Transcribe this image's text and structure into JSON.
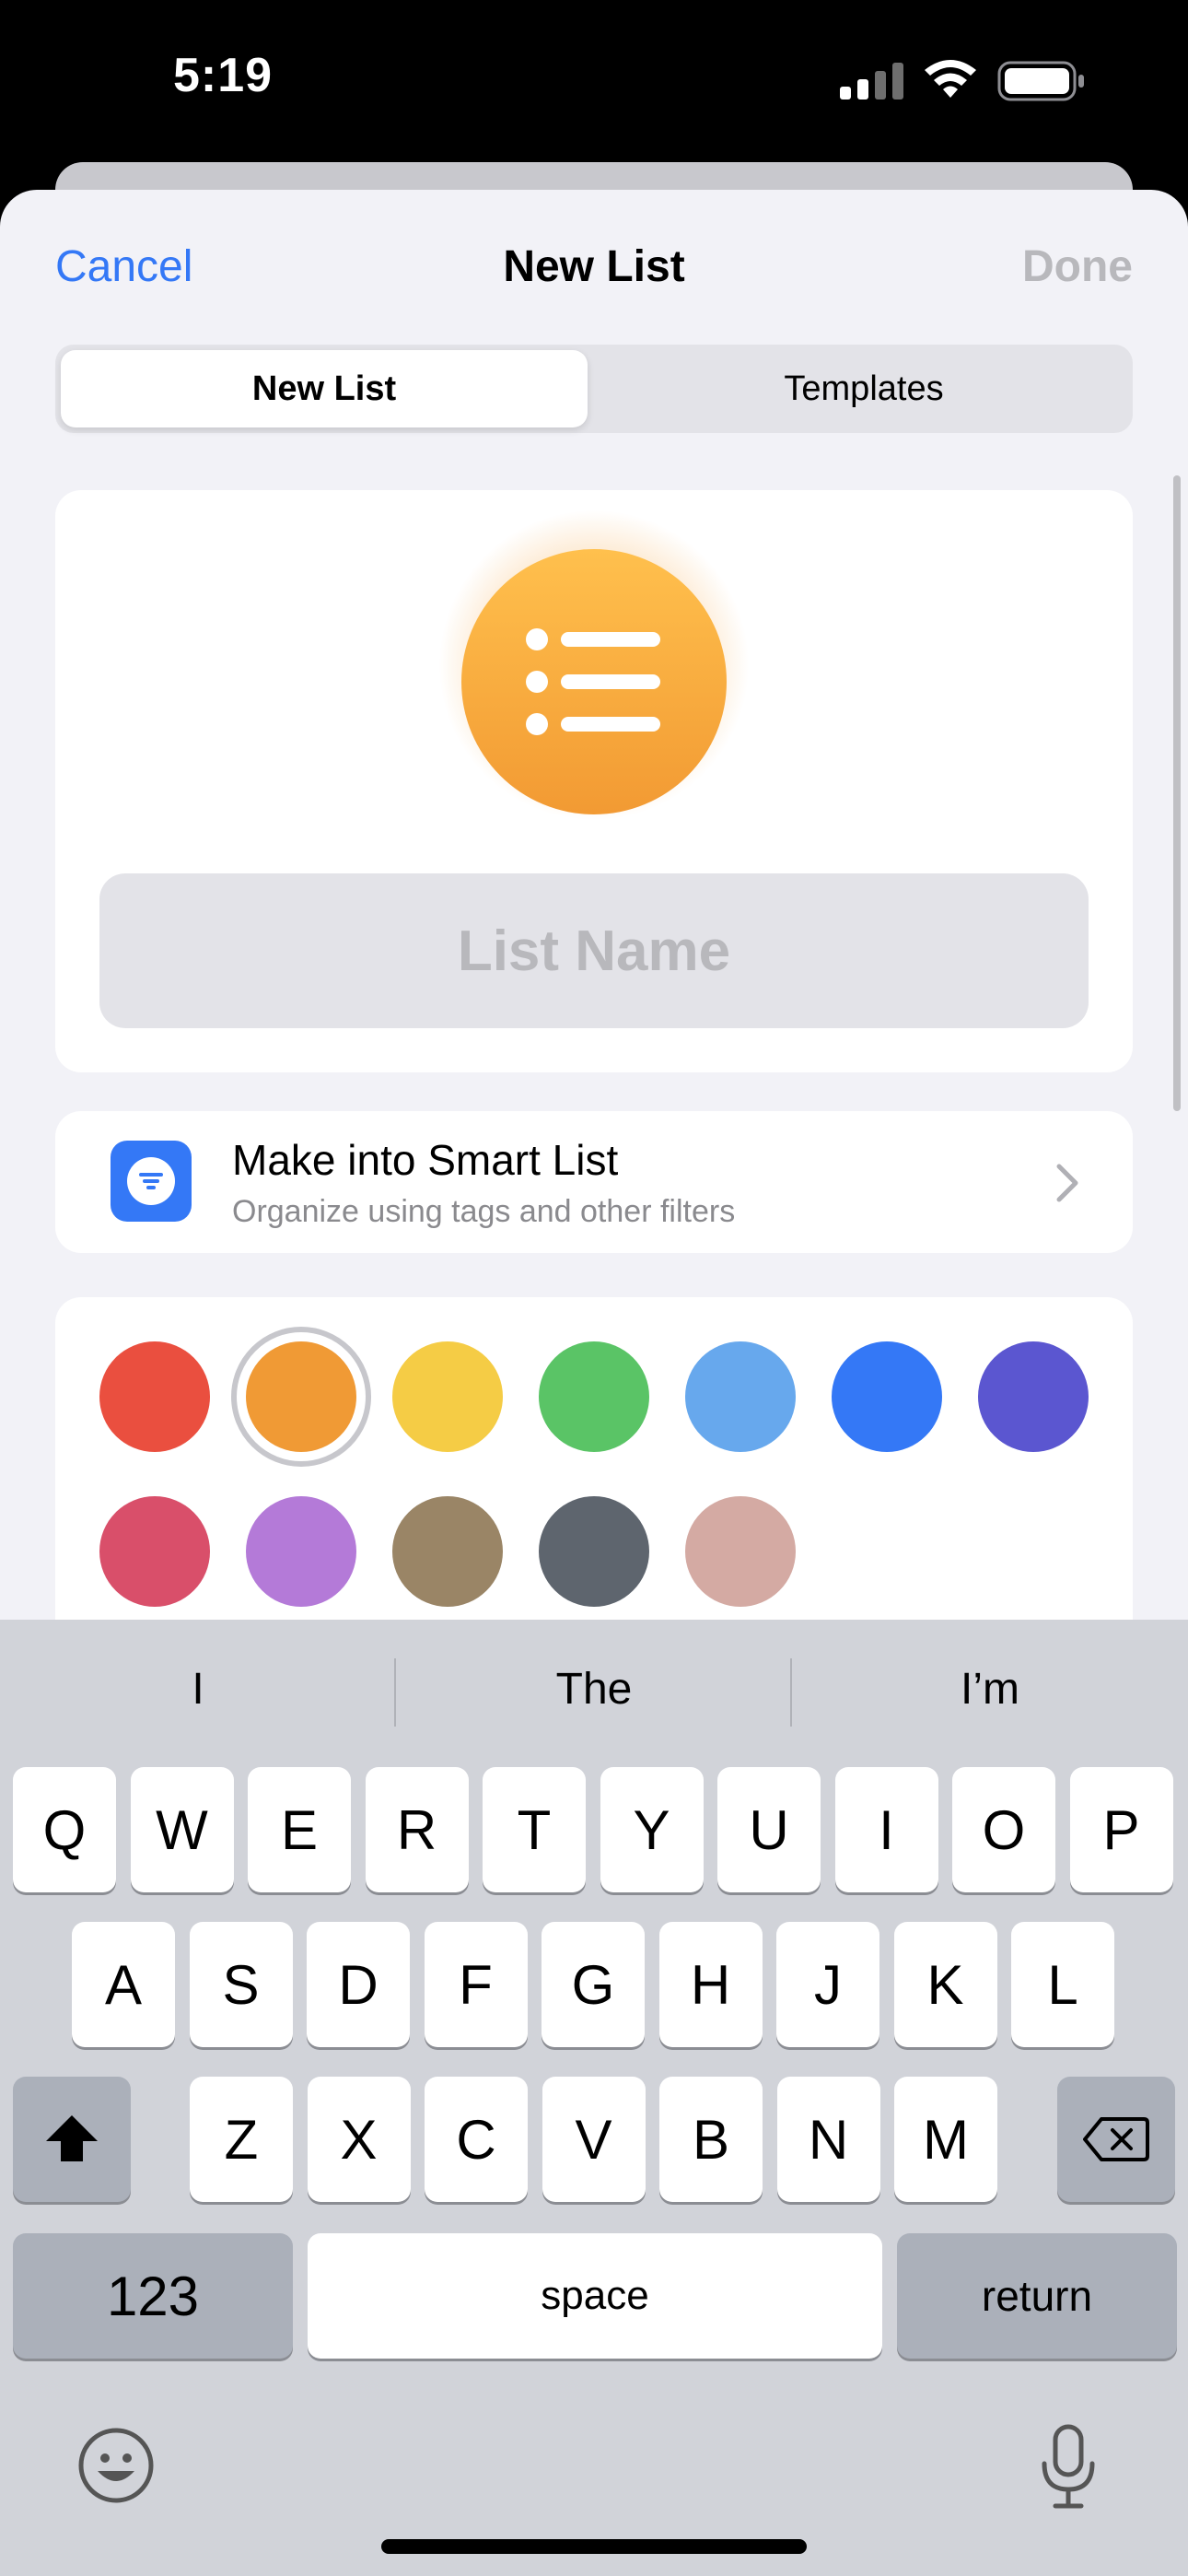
{
  "status_bar": {
    "time": "5:19"
  },
  "nav": {
    "cancel": "Cancel",
    "title": "New List",
    "done": "Done"
  },
  "segmented": {
    "new_list": "New List",
    "templates": "Templates"
  },
  "list_name": {
    "placeholder": "List Name",
    "value": ""
  },
  "smart_list": {
    "title": "Make into Smart List",
    "subtitle": "Organize using tags and other filters"
  },
  "colors": {
    "selected": "#f09a35",
    "row1": [
      "#ea4f3f",
      "#f09a35",
      "#f5cc45",
      "#5ac466",
      "#67a8ed",
      "#3478f6",
      "#5b56d0"
    ],
    "row2": [
      "#d94f6a",
      "#b47ad8",
      "#9a8566",
      "#5e656e",
      "#d4aaa3"
    ]
  },
  "keyboard": {
    "suggestions": [
      "I",
      "The",
      "I’m"
    ],
    "row1": [
      "Q",
      "W",
      "E",
      "R",
      "T",
      "Y",
      "U",
      "I",
      "O",
      "P"
    ],
    "row2": [
      "A",
      "S",
      "D",
      "F",
      "G",
      "H",
      "J",
      "K",
      "L"
    ],
    "row3": [
      "Z",
      "X",
      "C",
      "V",
      "B",
      "N",
      "M"
    ],
    "numbers": "123",
    "space": "space",
    "return": "return"
  }
}
